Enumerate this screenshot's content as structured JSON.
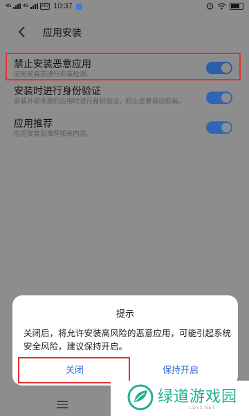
{
  "status_bar": {
    "signal_1": "4G",
    "signal_2": "4G",
    "hd": "HD",
    "time": "10:37",
    "battery": "battery-icon"
  },
  "header": {
    "title": "应用安装"
  },
  "settings": [
    {
      "title": "禁止安装恶意应用",
      "desc": "应用安装前进行安装检测。",
      "enabled": true
    },
    {
      "title": "安装时进行身份验证",
      "desc": "安装外部来源的应用时进行身份验证，防止恶意自动安装。",
      "enabled": true
    },
    {
      "title": "应用推荐",
      "desc": "应用安装后推荐相关内容。",
      "enabled": true
    }
  ],
  "dialog": {
    "title": "提示",
    "message": "关闭后，将允许安装高风险的恶意应用，可能引起系统安全风险，建议保持开启。",
    "close_label": "关闭",
    "keep_label": "保持开启"
  },
  "watermark": {
    "text": "绿道游戏园",
    "sub": "LDYX.NET"
  },
  "colors": {
    "accent": "#3a6fd0",
    "highlight": "#e53030",
    "watermark": "#23b08e"
  }
}
